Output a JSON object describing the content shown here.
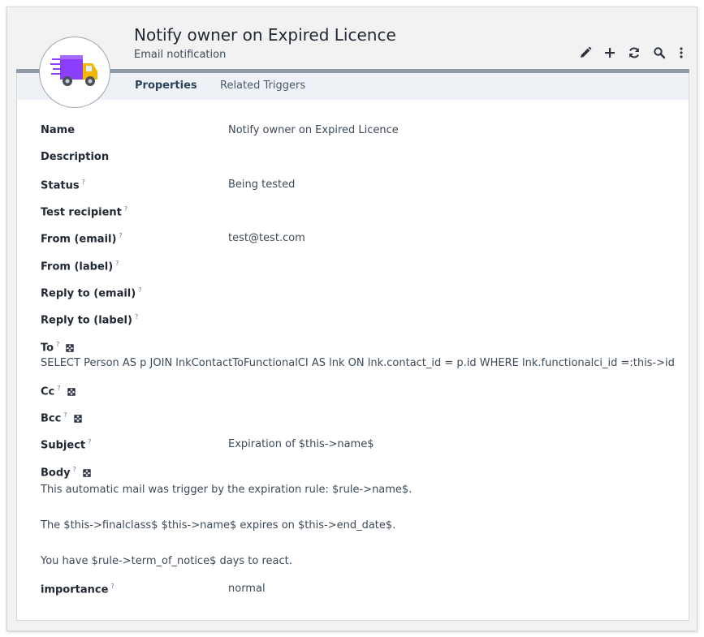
{
  "header": {
    "title": "Notify owner on Expired Licence",
    "subtitle": "Email notification",
    "icon": "truck-icon"
  },
  "toolbar": {
    "buttons": [
      "edit-icon",
      "plus-icon",
      "refresh-icon",
      "search-icon",
      "more-icon"
    ]
  },
  "tabs": [
    {
      "label": "Properties",
      "active": true
    },
    {
      "label": "Related Triggers",
      "active": false
    }
  ],
  "fields": {
    "name": {
      "label": "Name",
      "value": "Notify owner on Expired Licence"
    },
    "description": {
      "label": "Description",
      "value": ""
    },
    "status": {
      "label": "Status",
      "help": "?",
      "value": "Being tested"
    },
    "test_recipient": {
      "label": "Test recipient",
      "help": "?",
      "value": ""
    },
    "from_email": {
      "label": "From (email)",
      "help": "?",
      "value": "test@test.com"
    },
    "from_label": {
      "label": "From (label)",
      "help": "?",
      "value": ""
    },
    "reply_email": {
      "label": "Reply to (email)",
      "help": "?",
      "value": ""
    },
    "reply_label": {
      "label": "Reply to (label)",
      "help": "?",
      "value": ""
    },
    "to": {
      "label": "To",
      "help": "?",
      "value": "SELECT Person AS p JOIN lnkContactToFunctionalCI AS lnk ON lnk.contact_id = p.id WHERE lnk.functionalci_id =:this->id"
    },
    "cc": {
      "label": "Cc",
      "help": "?",
      "value": ""
    },
    "bcc": {
      "label": "Bcc",
      "help": "?",
      "value": ""
    },
    "subject": {
      "label": "Subject",
      "help": "?",
      "value": "Expiration of $this->name$"
    },
    "body": {
      "label": "Body",
      "help": "?",
      "lines": [
        "This automatic mail was trigger by the expiration rule: $rule->name$.",
        "The $this->finalclass$ $this->name$ expires on $this->end_date$.",
        "You have $rule->term_of_notice$ days to react."
      ]
    },
    "importance": {
      "label": "importance",
      "help": "?",
      "value": "normal"
    }
  },
  "colors": {
    "accent": "#909ba8",
    "tab_bar": "#eef2f6",
    "truck_purple": "#8a3ffc",
    "truck_yellow": "#f2b705"
  }
}
